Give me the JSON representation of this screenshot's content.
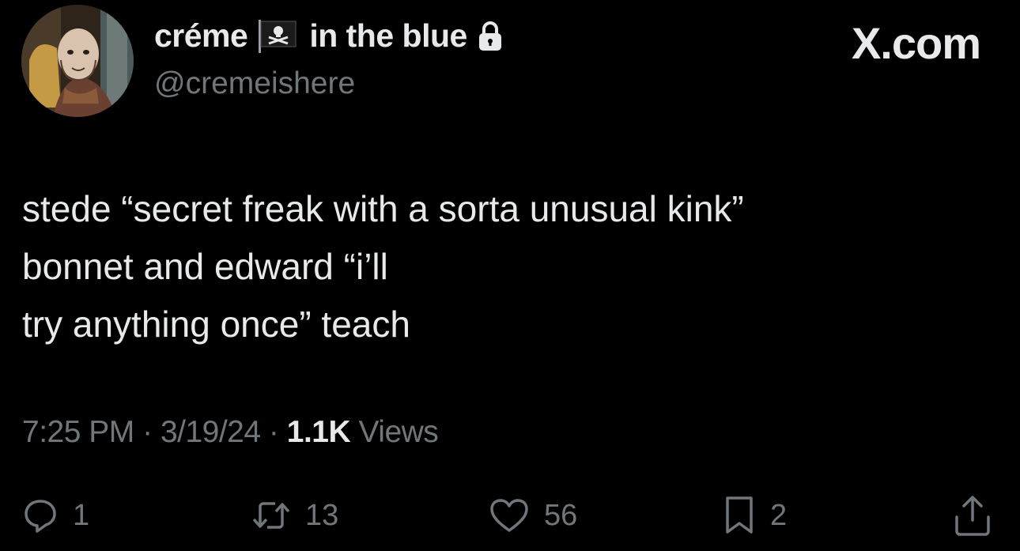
{
  "user": {
    "display_name_part1": "créme",
    "display_name_part2": "in the blue",
    "handle": "@cremeishere",
    "flag_icon": "pirate-flag-icon",
    "lock_icon": "lock-icon"
  },
  "brand": "X.com",
  "tweet": {
    "lines": [
      "stede “secret freak with a sorta unusual kink”",
      "bonnet and edward “i’ll",
      "try anything once” teach"
    ]
  },
  "meta": {
    "time": "7:25 PM",
    "date": "3/19/24",
    "views_count": "1.1K",
    "views_label": "Views",
    "separator": "·"
  },
  "actions": {
    "replies": "1",
    "reposts": "13",
    "likes": "56",
    "bookmarks": "2"
  },
  "colors": {
    "background": "#000000",
    "text": "#e7e9ea",
    "muted": "#71767b"
  }
}
